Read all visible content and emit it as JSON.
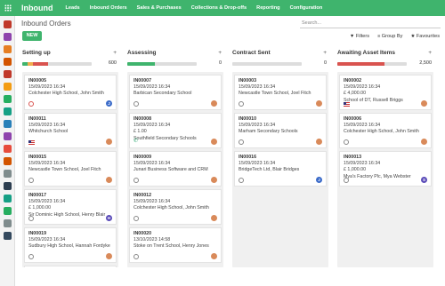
{
  "app": {
    "title": "Inbound"
  },
  "menu": [
    "Leads",
    "Inbound Orders",
    "Sales & Purchases",
    "Collections & Drop-offs",
    "Reporting",
    "Configuration"
  ],
  "breadcrumb": "Inbound Orders",
  "search": {
    "placeholder": "Search..."
  },
  "buttons": {
    "new": "NEW"
  },
  "filters": {
    "filters": "Filters",
    "group_by": "Group By",
    "favourites": "Favourites"
  },
  "colors": {
    "primary": "#3fb46d",
    "red": "#d9534f",
    "orange": "#f0ad4e"
  },
  "columns": [
    {
      "title": "Setting up",
      "count": "600",
      "progress": [
        {
          "color": "#3fb46d",
          "fraction": 0.08
        },
        {
          "color": "#f0ad4e",
          "fraction": 0.07
        },
        {
          "color": "#d9534f",
          "fraction": 0.22
        }
      ],
      "cards": [
        {
          "ref": "IN00005",
          "date": "15/09/2023 16:34",
          "lines": [
            "Colchester High School, John Smith"
          ],
          "icon": "clock-red",
          "avatar": "J",
          "avatar_color": "#3b6bc9"
        },
        {
          "ref": "IN00011",
          "date": "15/09/2023 16:34",
          "lines": [
            "Whitchurch School"
          ],
          "icon": "flag",
          "avatar": "",
          "avatar_color": "#d98a5a"
        },
        {
          "ref": "IN00015",
          "date": "15/09/2023 16:34",
          "lines": [
            "Newcastle Town School, Joel Fitch"
          ],
          "icon": "clock",
          "avatar": "",
          "avatar_color": "#d98a5a"
        },
        {
          "ref": "IN00017",
          "date": "15/09/2023 16:34",
          "lines": [
            "£ 1,000.00",
            "Sir Dominic High School, Henry Blair"
          ],
          "icon": "clock",
          "avatar": "H",
          "avatar_color": "#5a4bb8"
        },
        {
          "ref": "IN00019",
          "date": "15/09/2023 16:34",
          "lines": [
            "Sudbury High School, Hannah Fordyke"
          ],
          "icon": "clock",
          "avatar": "",
          "avatar_color": "#d98a5a"
        },
        {
          "ref": "IN00019",
          "date": "",
          "lines": [],
          "icon": "",
          "avatar": "",
          "avatar_color": "#fff"
        }
      ]
    },
    {
      "title": "Assessing",
      "count": "0",
      "progress": [
        {
          "color": "#3fb46d",
          "fraction": 0.4
        }
      ],
      "cards": [
        {
          "ref": "IN00007",
          "date": "15/09/2023 16:34",
          "lines": [
            "Barbican Secondary School"
          ],
          "icon": "clock",
          "avatar": "",
          "avatar_color": "#d98a5a"
        },
        {
          "ref": "IN00008",
          "date": "15/09/2023 16:34",
          "lines": [
            "£ 1.00",
            "Southfield Secondary Schools"
          ],
          "icon": "phone",
          "avatar": "",
          "avatar_color": "#d98a5a"
        },
        {
          "ref": "IN00009",
          "date": "15/09/2023 16:34",
          "lines": [
            "Junari Business Software and CRM"
          ],
          "icon": "clock",
          "avatar": "",
          "avatar_color": "#d98a5a"
        },
        {
          "ref": "IN00012",
          "date": "15/09/2023 16:34",
          "lines": [
            "Colchester High School, John Smith"
          ],
          "icon": "clock",
          "avatar": "",
          "avatar_color": "#d98a5a"
        },
        {
          "ref": "IN00020",
          "date": "13/10/2023 14:58",
          "lines": [
            "Stoke on Trent School, Henry Jones"
          ],
          "icon": "clock",
          "avatar": "",
          "avatar_color": "#d98a5a"
        }
      ]
    },
    {
      "title": "Contract Sent",
      "count": "0",
      "progress": [],
      "cards": [
        {
          "ref": "IN00003",
          "date": "15/09/2023 16:34",
          "lines": [
            "Newcastle Town School, Joel Fitch"
          ],
          "icon": "clock",
          "avatar": "",
          "avatar_color": "#d98a5a"
        },
        {
          "ref": "IN00010",
          "date": "15/09/2023 16:34",
          "lines": [
            "Marham Secondary Schools"
          ],
          "icon": "clock",
          "avatar": "",
          "avatar_color": "#d98a5a"
        },
        {
          "ref": "IN00016",
          "date": "15/09/2023 16:34",
          "lines": [
            "BridgeTech Ltd, Blair Bridges"
          ],
          "icon": "clock",
          "avatar": "J",
          "avatar_color": "#3b6bc9"
        }
      ]
    },
    {
      "title": "Awaiting Asset Items",
      "count": "2,500",
      "progress": [
        {
          "color": "#d9534f",
          "fraction": 0.68
        }
      ],
      "cards": [
        {
          "ref": "IN00002",
          "date": "15/09/2023 16:34",
          "lines": [
            "£ 4,000.00",
            "School of DT, Russell Briggs"
          ],
          "icon": "flag",
          "avatar": "",
          "avatar_color": "#d98a5a"
        },
        {
          "ref": "IN00006",
          "date": "15/09/2023 16:34",
          "lines": [
            "Colchester High School, John Smith"
          ],
          "icon": "clock",
          "avatar": "",
          "avatar_color": "#d98a5a"
        },
        {
          "ref": "IN00013",
          "date": "15/09/2023 16:34",
          "lines": [
            "£ 1,000.00",
            "Mya's Factory Plc, Mya Webster"
          ],
          "icon": "clock",
          "avatar": "S",
          "avatar_color": "#5a4bb8"
        }
      ]
    }
  ]
}
